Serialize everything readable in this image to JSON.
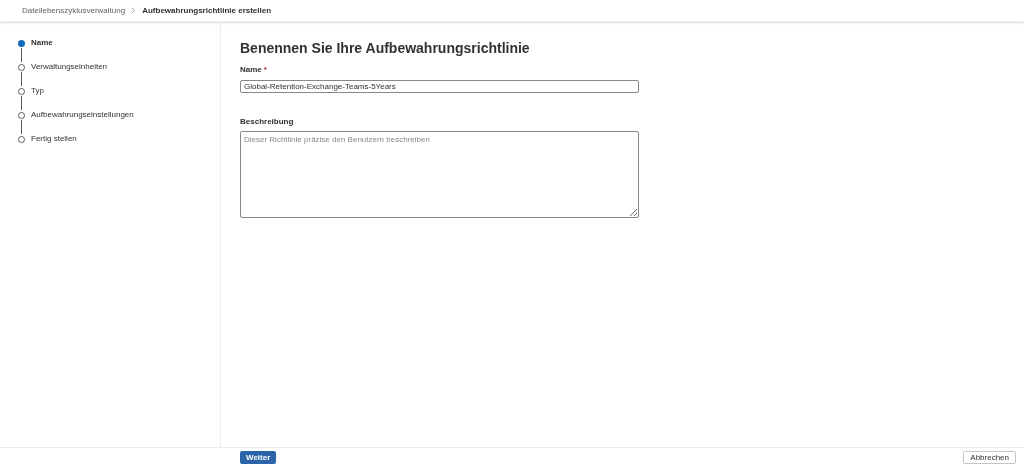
{
  "breadcrumb": [
    {
      "label": "Dateilebenszyklusverwaltung",
      "current": false
    },
    {
      "label": "Aufbewahrungsrichtlinie erstellen",
      "current": true
    }
  ],
  "steps": [
    {
      "label": "Name",
      "selected": true
    },
    {
      "label": "Verwaltungseinheiten",
      "selected": false
    },
    {
      "label": "Typ",
      "selected": false
    },
    {
      "label": "Aufbewahrungseinstellungen",
      "selected": false
    },
    {
      "label": "Fertig stellen",
      "selected": false
    }
  ],
  "form": {
    "title": "Benennen Sie Ihre Aufbewahrungsrichtlinie",
    "name_field": {
      "label": "Name",
      "required_mark": "*",
      "value": "Global-Retention-Exchange-Teams-5Years"
    },
    "description_field": {
      "label": "Beschreibung",
      "placeholder": "Dieser Richtlinie präzise den Benutzern beschreiben"
    }
  },
  "footer": {
    "next_button": "Weiter",
    "cancel_button": "Abbrechen"
  }
}
